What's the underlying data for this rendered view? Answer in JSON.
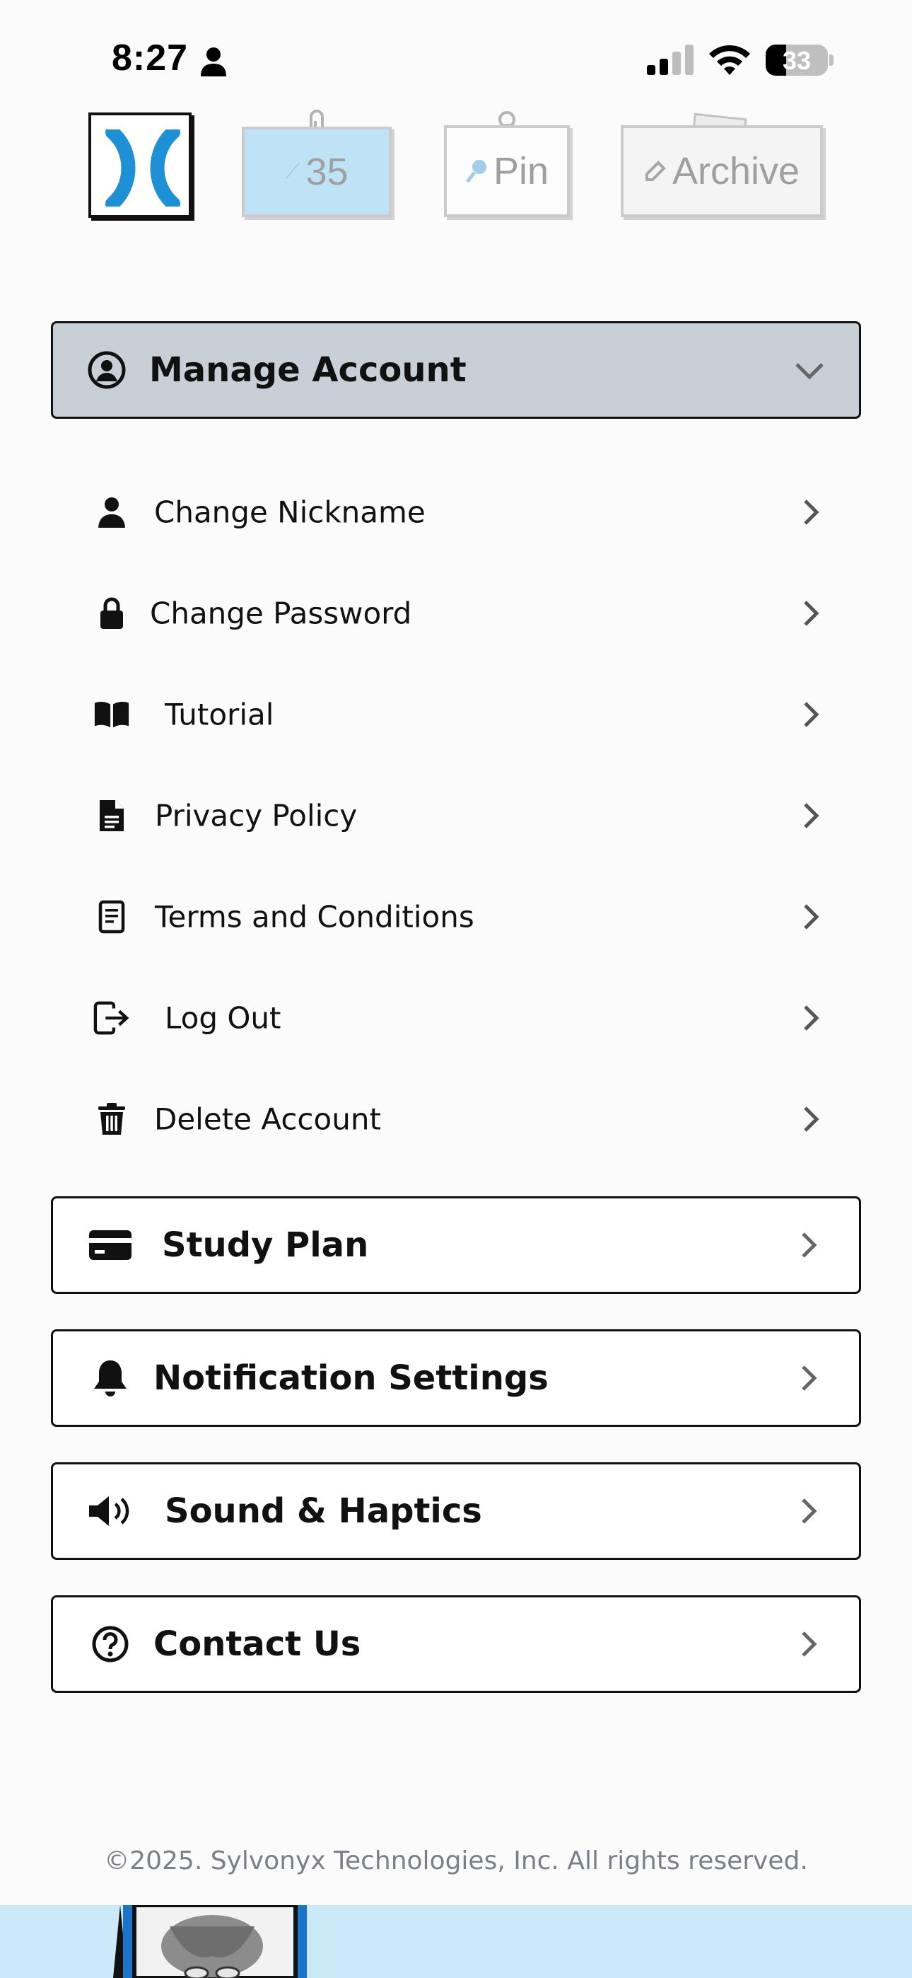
{
  "status_bar": {
    "time": "8:27",
    "battery": "33",
    "battery_level": 0.33
  },
  "top_tabs": {
    "notes_count": "35",
    "pin_label": "Pin",
    "archive_label": "Archive"
  },
  "account": {
    "header_label": "Manage Account",
    "items": [
      {
        "label": "Change Nickname",
        "icon": "person-icon"
      },
      {
        "label": "Change Password",
        "icon": "lock-icon"
      },
      {
        "label": "Tutorial",
        "icon": "book-icon"
      },
      {
        "label": "Privacy Policy",
        "icon": "document-icon"
      },
      {
        "label": "Terms and Conditions",
        "icon": "terms-icon"
      },
      {
        "label": "Log Out",
        "icon": "logout-icon"
      },
      {
        "label": "Delete Account",
        "icon": "trash-icon"
      }
    ]
  },
  "sections": [
    {
      "label": "Study Plan",
      "icon": "card-icon"
    },
    {
      "label": "Notification Settings",
      "icon": "bell-icon"
    },
    {
      "label": "Sound & Haptics",
      "icon": "speaker-icon"
    },
    {
      "label": "Contact Us",
      "icon": "question-circle-icon"
    }
  ],
  "footer": {
    "copyright": "©2025. Sylvonyx Technologies, Inc. All rights reserved."
  },
  "colors": {
    "background": "#fbfbfc",
    "header_bg": "#c9cfd7",
    "brand_blue": "#1e90d6",
    "notes_blue": "#6fc4ef",
    "border": "#111111",
    "footer_text": "#7b7f87",
    "bottom_strip": "#cbe9f6"
  }
}
